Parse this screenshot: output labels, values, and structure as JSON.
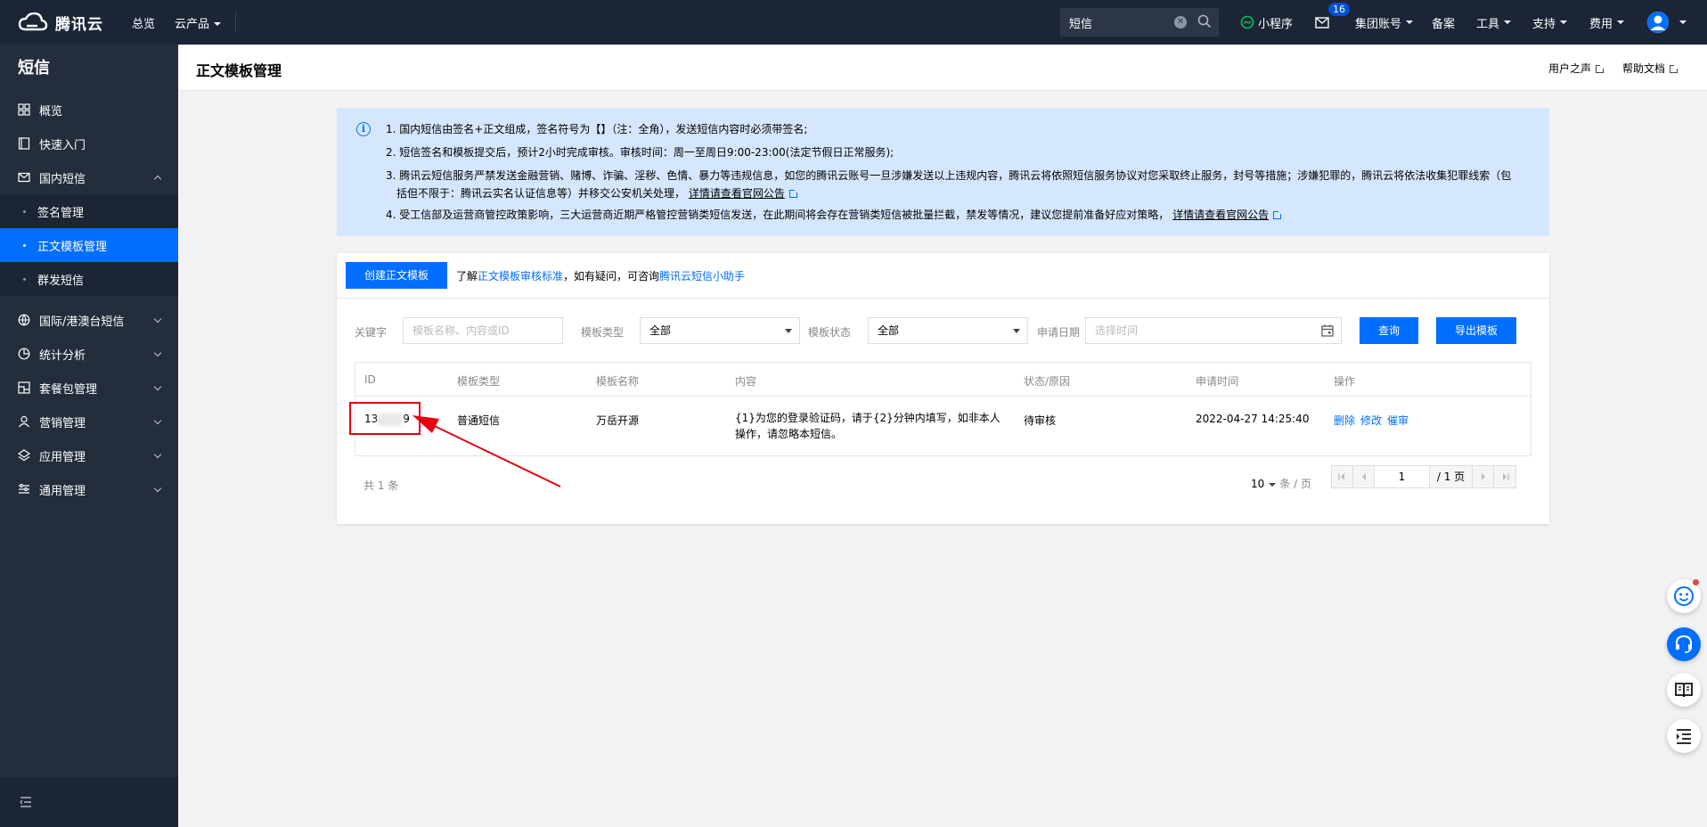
{
  "topbar": {
    "brand": "腾讯云",
    "nav_overview": "总览",
    "nav_products": "云产品",
    "search_value": "短信",
    "miniprogram": "小程序",
    "mail_badge": "16",
    "group_account": "集团账号",
    "filing": "备案",
    "tools": "工具",
    "support": "支持",
    "billing": "费用"
  },
  "sidebar": {
    "title": "短信",
    "items": [
      {
        "label": "概览",
        "icon": "grid-icon"
      },
      {
        "label": "快速入门",
        "icon": "book-icon"
      },
      {
        "label": "国内短信",
        "icon": "mail-icon",
        "expanded": true
      },
      {
        "label": "国际/港澳台短信",
        "icon": "globe-icon"
      },
      {
        "label": "统计分析",
        "icon": "pie-chart-icon"
      },
      {
        "label": "套餐包管理",
        "icon": "package-icon"
      },
      {
        "label": "营销管理",
        "icon": "user-icon"
      },
      {
        "label": "应用管理",
        "icon": "layers-icon"
      },
      {
        "label": "通用管理",
        "icon": "settings-list-icon"
      }
    ],
    "subitems": [
      {
        "label": "签名管理"
      },
      {
        "label": "正文模板管理",
        "active": true
      },
      {
        "label": "群发短信"
      }
    ]
  },
  "header": {
    "title": "正文模板管理",
    "user_voice": "用户之声",
    "help_docs": "帮助文档"
  },
  "notice": {
    "line1": "1. 国内短信由签名+正文组成，签名符号为【】（注：全角），发送短信内容时必须带签名;",
    "line2": "2. 短信签名和模板提交后，预计2小时完成审核。审核时间：周一至周日9:00-23:00(法定节假日正常服务);",
    "line3a": "3. 腾讯云短信服务严禁发送金融营销、赌博、诈骗、淫秽、色情、暴力等违规信息，如您的腾讯云账号一旦涉嫌发送以上违规内容，腾讯云将依照短信服务协议对您采取终止服务，封号等措施；涉嫌犯罪的，腾讯云将依法收集犯罪线索（包",
    "line3b": "括但不限于：腾讯云实名认证信息等）并移交公安机关处理，",
    "line3_link": "详情请查看官网公告",
    "line4": "4. 受工信部及运营商管控政策影响，三大运营商近期严格管控营销类短信发送，在此期间将会存在营销类短信被批量拦截，禁发等情况，建议您提前准备好应对策略，",
    "line4_link": "详情请查看官网公告"
  },
  "toolbar": {
    "create_button": "创建正文模板",
    "help_prefix": "了解",
    "help_link1": "正文模板审核标准",
    "help_middle": "，如有疑问，可咨询",
    "help_link2": "腾讯云短信小助手"
  },
  "filters": {
    "keyword_label": "关键字",
    "keyword_placeholder": "模板名称、内容或ID",
    "type_label": "模板类型",
    "type_value": "全部",
    "status_label": "模板状态",
    "status_value": "全部",
    "date_label": "申请日期",
    "date_placeholder": "选择时间",
    "query_button": "查询",
    "export_button": "导出模板"
  },
  "table": {
    "headers": [
      "ID",
      "模板类型",
      "模板名称",
      "内容",
      "状态/原因",
      "申请时间",
      "操作"
    ],
    "rows": [
      {
        "id_prefix": "13",
        "id_suffix": "9",
        "type": "普通短信",
        "name": "万岳开源",
        "content": "{1}为您的登录验证码，请于{2}分钟内填写，如非本人操作，请忽略本短信。",
        "status": "待审核",
        "time": "2022-04-27 14:25:40",
        "actions": [
          "删除",
          "修改",
          "催审"
        ]
      }
    ]
  },
  "pagination": {
    "total": "共 1 条",
    "page_size": "10",
    "page_size_unit": "条 / 页",
    "current_page": "1",
    "total_pages": "/ 1 页"
  },
  "colors": {
    "accent": "#006eff",
    "topbar": "#1b2536",
    "sidebar": "#232d3c",
    "notice_bg": "#d5e7ff",
    "annotation_red": "#e60012"
  }
}
